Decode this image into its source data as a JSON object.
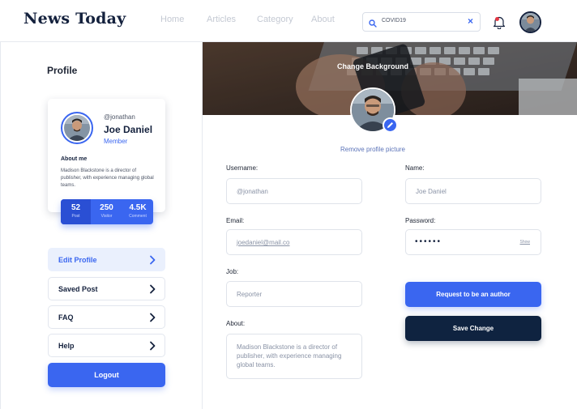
{
  "header": {
    "brand": "News Today",
    "nav": [
      "Home",
      "Articles",
      "Category",
      "About"
    ],
    "search": {
      "value": "COVID19",
      "icon": "search-icon",
      "clear_icon": "close-icon"
    },
    "notification_icon": "bell-icon"
  },
  "sidebar": {
    "title": "Profile",
    "card": {
      "handle": "@jonathan",
      "name": "Joe Daniel",
      "role": "Member",
      "about_title": "About me",
      "about_text": "Madison Blackstone is a director of publisher, with experience managing global teams."
    },
    "stats": [
      {
        "value": "52",
        "label": "Post"
      },
      {
        "value": "250",
        "label": "Visitor"
      },
      {
        "value": "4.5K",
        "label": "Comment"
      }
    ],
    "menu": [
      {
        "label": "Edit Profile",
        "active": true
      },
      {
        "label": "Saved Post",
        "active": false
      },
      {
        "label": "FAQ",
        "active": false
      },
      {
        "label": "Help",
        "active": false
      }
    ],
    "logout_label": "Logout"
  },
  "main": {
    "cover_label": "Change Background",
    "remove_picture": "Remove profile picture",
    "form": {
      "username": {
        "label": "Username:",
        "value": "@jonathan"
      },
      "name": {
        "label": "Name:",
        "value": "Joe Daniel"
      },
      "email": {
        "label": "Email:",
        "value": "joedaniel@mail.co"
      },
      "password": {
        "label": "Password:",
        "value": "••••••",
        "show": "Show"
      },
      "job": {
        "label": "Job:",
        "value": "Reporter"
      },
      "about": {
        "label": "About:",
        "value": "Madison Blackstone is a director of publisher, with experience managing global teams."
      }
    },
    "request_button": "Request to be an author",
    "save_button": "Save Change"
  },
  "colors": {
    "accent": "#3a66f0",
    "dark": "#0f2340",
    "notification": "#e53945"
  }
}
